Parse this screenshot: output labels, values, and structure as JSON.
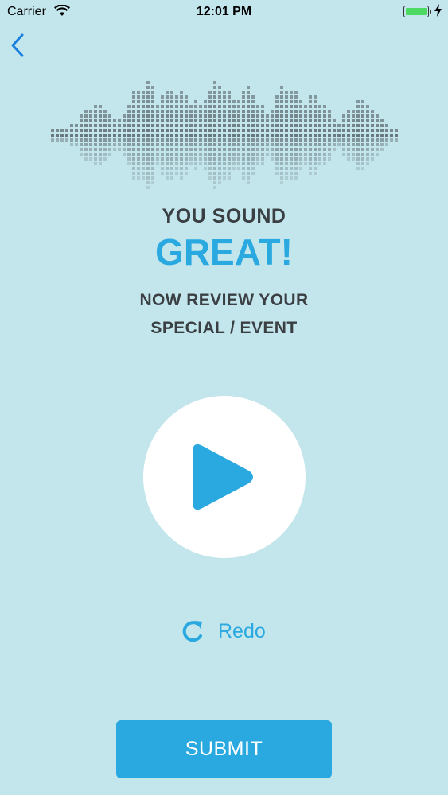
{
  "status_bar": {
    "carrier": "Carrier",
    "time": "12:01 PM"
  },
  "nav": {
    "back_icon": "chevron-left-icon"
  },
  "headline": {
    "line1": "YOU SOUND",
    "line2": "GREAT!"
  },
  "subheadline": {
    "line1": "NOW REVIEW YOUR",
    "line2": "SPECIAL / EVENT"
  },
  "player": {
    "play_icon": "play-icon"
  },
  "redo": {
    "label": "Redo",
    "icon": "refresh-icon"
  },
  "submit": {
    "label": "SUBMIT"
  },
  "colors": {
    "background": "#c3e6ec",
    "accent": "#29a9e0",
    "text_dark": "#3a3f44",
    "battery": "#4cd964"
  }
}
